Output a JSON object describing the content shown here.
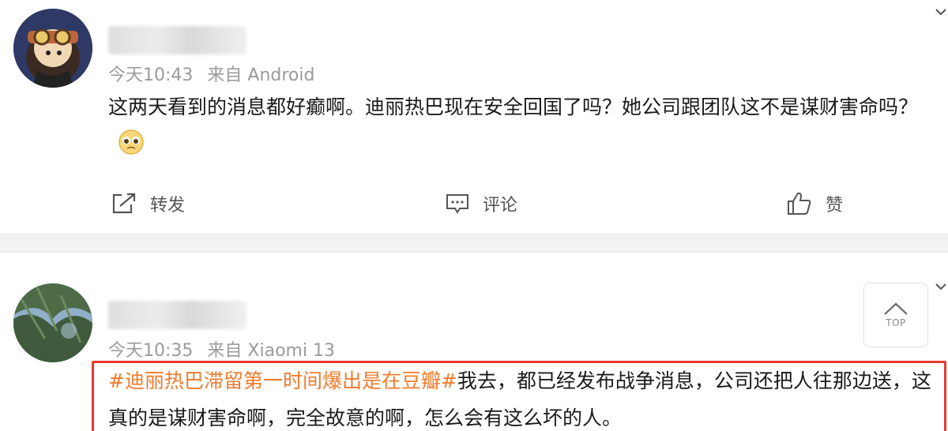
{
  "posts": [
    {
      "time": "今天10:43",
      "source": "来自 Android",
      "text": "这两天看到的消息都好癫啊。迪丽热巴现在安全回国了吗？她公司跟团队这不是谋财害命吗？",
      "emoji": "pleading-face-emoji"
    },
    {
      "time": "今天10:35",
      "source": "来自 Xiaomi 13",
      "topic": "#迪丽热巴滞留第一时间爆出是在豆瓣#",
      "text": "我去，都已经发布战争消息，公司还把人往那边送，这真的是谋财害命啊，完全故意的啊，怎么会有这么坏的人。"
    }
  ],
  "actions": {
    "repost": "转发",
    "comment": "评论",
    "like": "赞"
  },
  "top_button": {
    "label": "TOP",
    "icon": "chevron-up-icon"
  },
  "colors": {
    "topic": "#f07b2c",
    "highlight_border": "#e53a30",
    "meta": "#9a9a9a",
    "separator": "#f2f2f2"
  }
}
